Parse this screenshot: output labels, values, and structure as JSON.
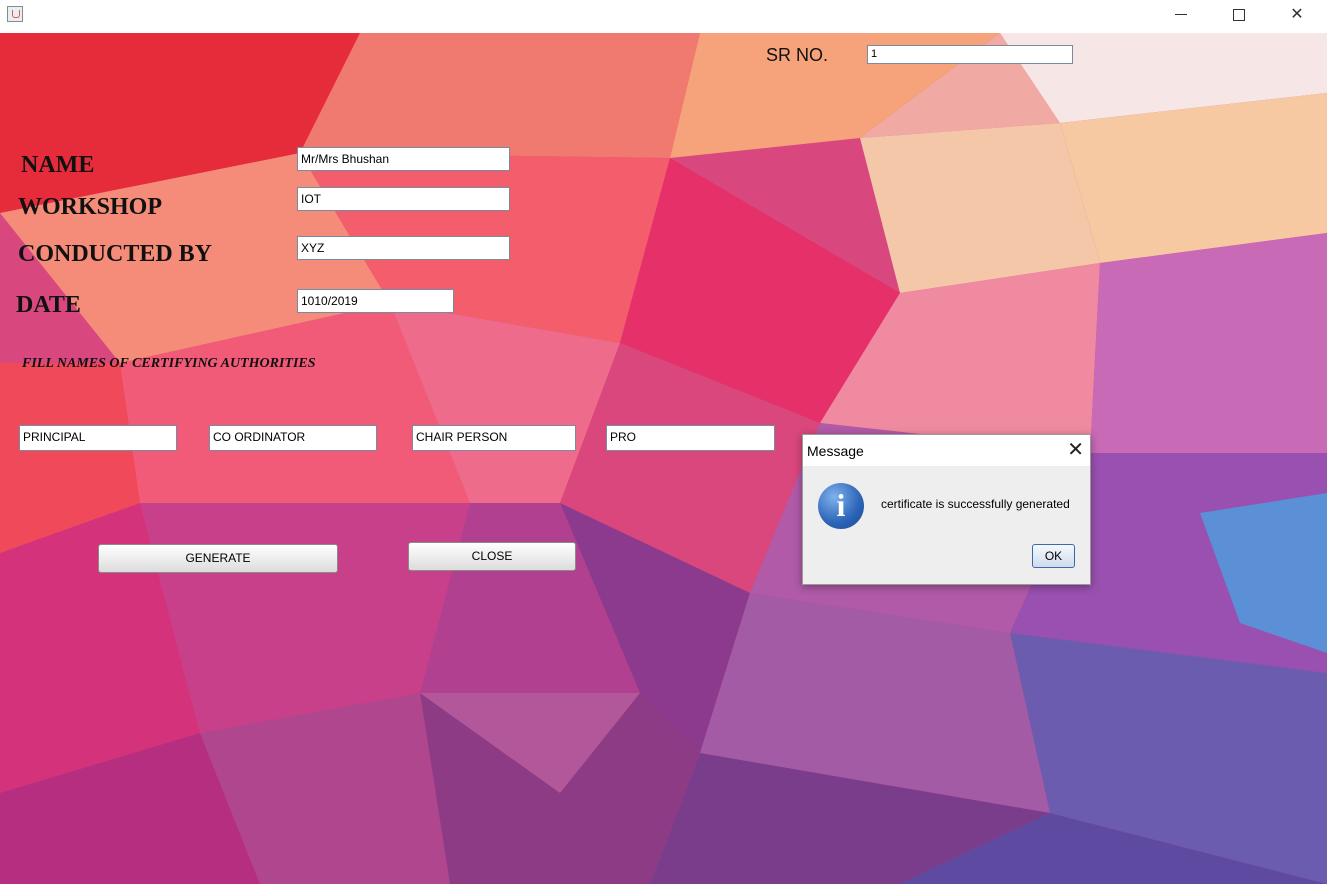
{
  "window": {
    "icon": "java-cup-icon",
    "controls": {
      "minimize": "minimize-icon",
      "maximize": "maximize-icon",
      "close": "close-icon"
    }
  },
  "form": {
    "sr_label": "SR NO.",
    "sr_value": "1",
    "name_label": "NAME",
    "name_value": "Mr/Mrs Bhushan",
    "workshop_label": "WORKSHOP",
    "workshop_value": "IOT",
    "conducted_label": "CONDUCTED BY",
    "conducted_value": "XYZ",
    "date_label": "DATE",
    "date_value": "1010/2019",
    "authorities_heading": "FILL NAMES OF CERTIFYING AUTHORITIES",
    "authorities": [
      "PRINCIPAL",
      "CO ORDINATOR",
      "CHAIR PERSON",
      "PRO"
    ],
    "generate_label": "GENERATE",
    "close_label": "CLOSE"
  },
  "dialog": {
    "title": "Message",
    "icon": "info-icon",
    "message": "certificate is successfully generated",
    "ok_label": "OK"
  }
}
